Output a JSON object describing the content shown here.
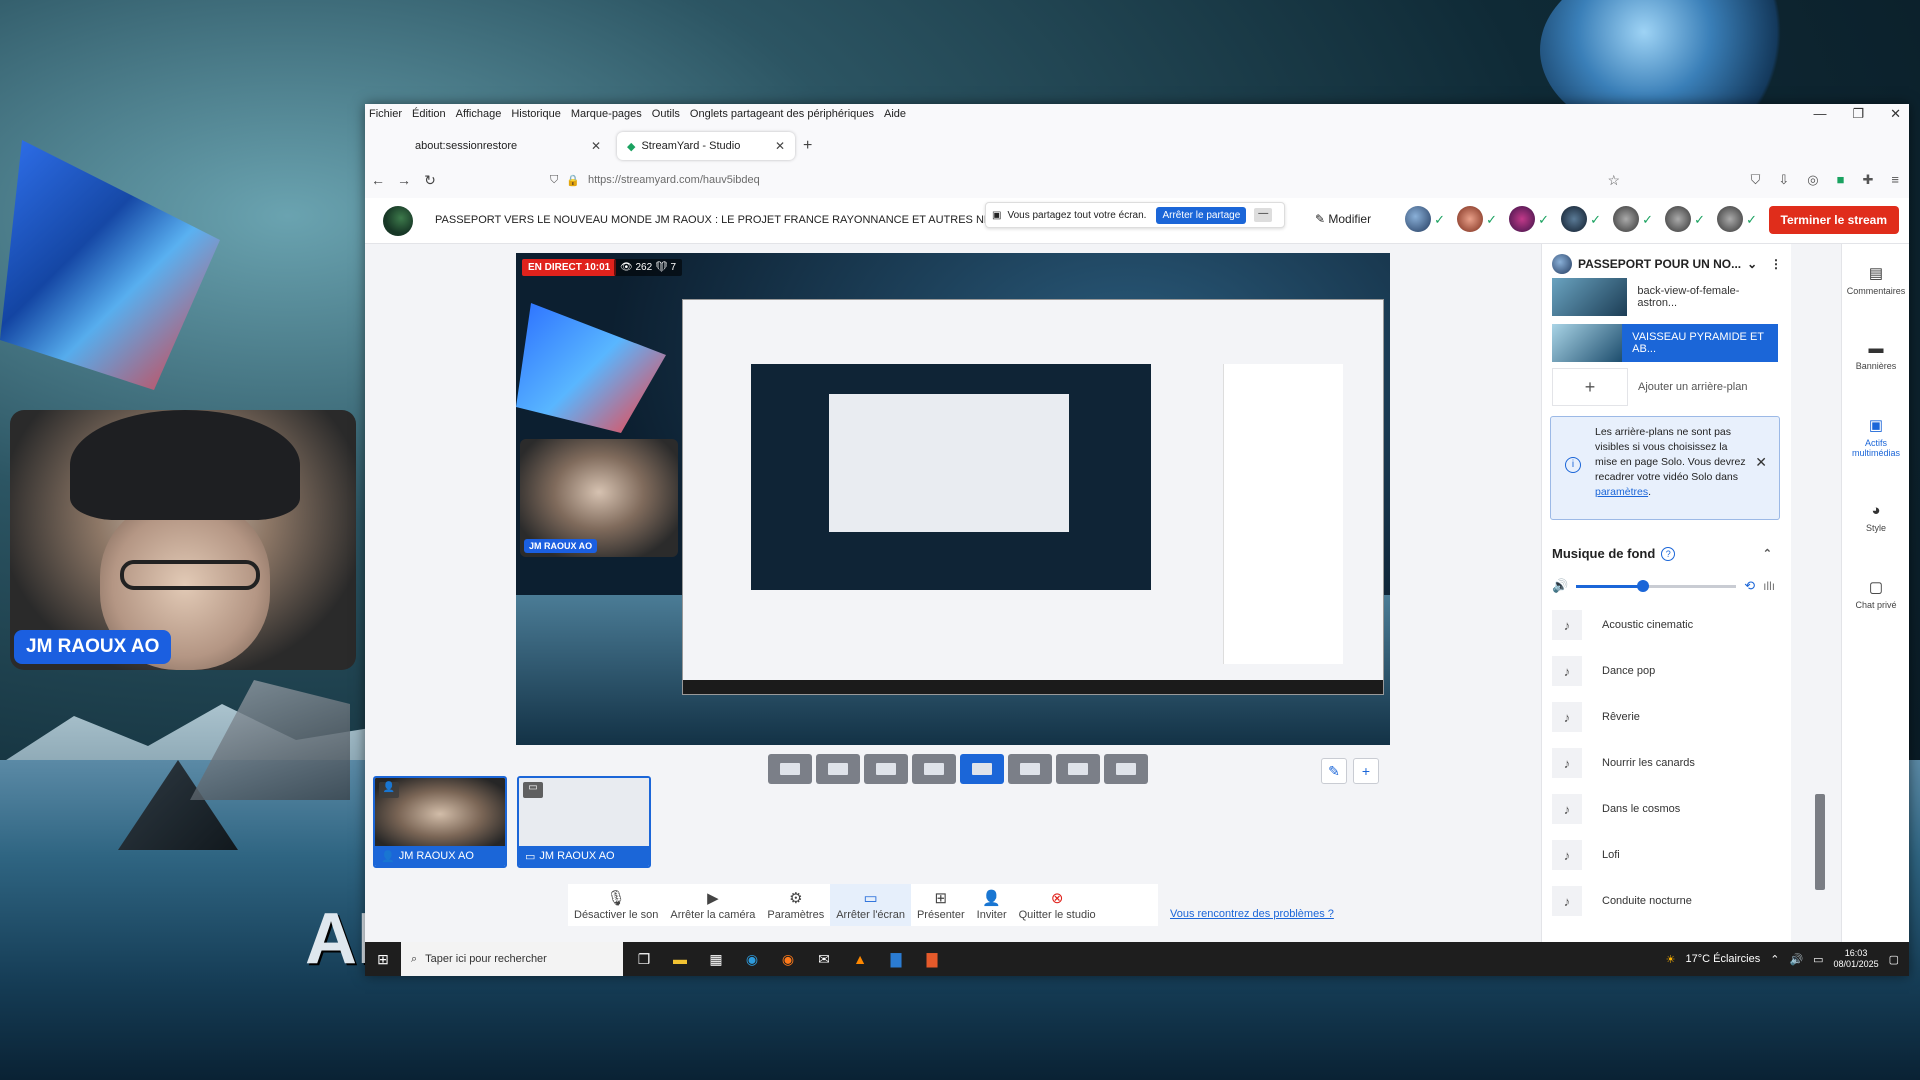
{
  "webcam_overlay": {
    "name": "JM RAOUX AO"
  },
  "background_text": "AI",
  "browser": {
    "menu": [
      "Fichier",
      "Édition",
      "Affichage",
      "Historique",
      "Marque-pages",
      "Outils",
      "Onglets partageant des périphériques",
      "Aide"
    ],
    "tabs": [
      {
        "label": "about:sessionrestore"
      },
      {
        "label": "StreamYard - Studio"
      }
    ],
    "url": "https://streamyard.com/hauv5ibdeq"
  },
  "header": {
    "title": "PASSEPORT VERS LE NOUVEAU MONDE JM RAOUX : LE PROJET FRANCE RAYONNANCE ET AUTRES NE...",
    "share_text": "Vous partagez tout votre écran.",
    "stop_share": "Arrêter le partage",
    "minimize": "—",
    "modify": "Modifier",
    "end_stream": "Terminer le stream"
  },
  "preview": {
    "live": "EN DIRECT 10:01",
    "viewers": "262",
    "reactions": "7",
    "cam_tag": "JM RAOUX AO"
  },
  "sources": [
    {
      "label": "JM RAOUX AO"
    },
    {
      "label": "JM RAOUX AO"
    }
  ],
  "controls": [
    {
      "label": "Désactiver le son",
      "icon": "microphone-icon"
    },
    {
      "label": "Arrêter la caméra",
      "icon": "camera-icon"
    },
    {
      "label": "Paramètres",
      "icon": "gear-icon"
    },
    {
      "label": "Arrêter l'écran",
      "icon": "screen-share-icon"
    },
    {
      "label": "Présenter",
      "icon": "present-icon"
    },
    {
      "label": "Inviter",
      "icon": "add-person-icon"
    },
    {
      "label": "Quitter le studio",
      "icon": "close-circle-icon"
    }
  ],
  "problems_link": "Vous rencontrez des problèmes ?",
  "panel": {
    "title": "PASSEPORT POUR UN NO...",
    "backgrounds": [
      {
        "label": "back-view-of-female-astron..."
      },
      {
        "label": "VAISSEAU PYRAMIDE ET AB..."
      }
    ],
    "add_background": "Ajouter un arrière-plan",
    "info": {
      "text": "Les arrière-plans ne sont pas visibles si vous choisissez la mise en page Solo. Vous devrez recadrer votre vidéo Solo dans",
      "link": "paramètres",
      "suffix": "."
    },
    "music_title": "Musique de fond",
    "volume_level": 0.42,
    "tracks": [
      "Acoustic cinematic",
      "Dance pop",
      "Rêverie",
      "Nourrir les canards",
      "Dans le cosmos",
      "Lofi",
      "Conduite nocturne"
    ]
  },
  "rail": [
    {
      "label": "Commentaires",
      "icon": "comment-icon"
    },
    {
      "label": "Bannières",
      "icon": "banner-icon"
    },
    {
      "label": "Actifs multimédias",
      "icon": "media-icon"
    },
    {
      "label": "Style",
      "icon": "palette-icon"
    },
    {
      "label": "Chat privé",
      "icon": "chat-icon"
    }
  ],
  "taskbar": {
    "search_placeholder": "Taper ici pour rechercher",
    "weather": "17°C  Éclaircies",
    "time": "16:03",
    "date": "08/01/2025"
  },
  "colors": {
    "accent": "#1b66d8",
    "live_red": "#e0221c",
    "end_red": "#e02d1b"
  }
}
